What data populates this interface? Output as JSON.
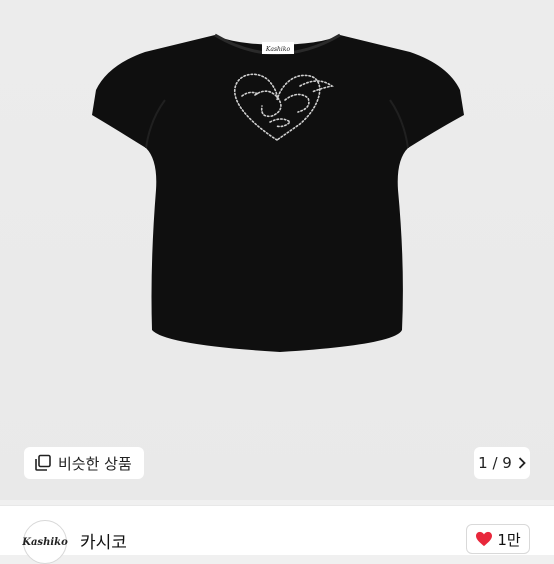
{
  "product": {
    "label_brand": "Kashiko"
  },
  "gallery": {
    "similar_label": "비슷한 상품",
    "pager_current": "1",
    "pager_total": "9",
    "pager_text": "1 / 9"
  },
  "seller": {
    "logo_text": "Kashiko",
    "name": "카시코"
  },
  "like": {
    "count": "1만"
  },
  "colors": {
    "shirt": "#0f0f0f",
    "heart": "#e8273b",
    "background": "#ececec"
  }
}
